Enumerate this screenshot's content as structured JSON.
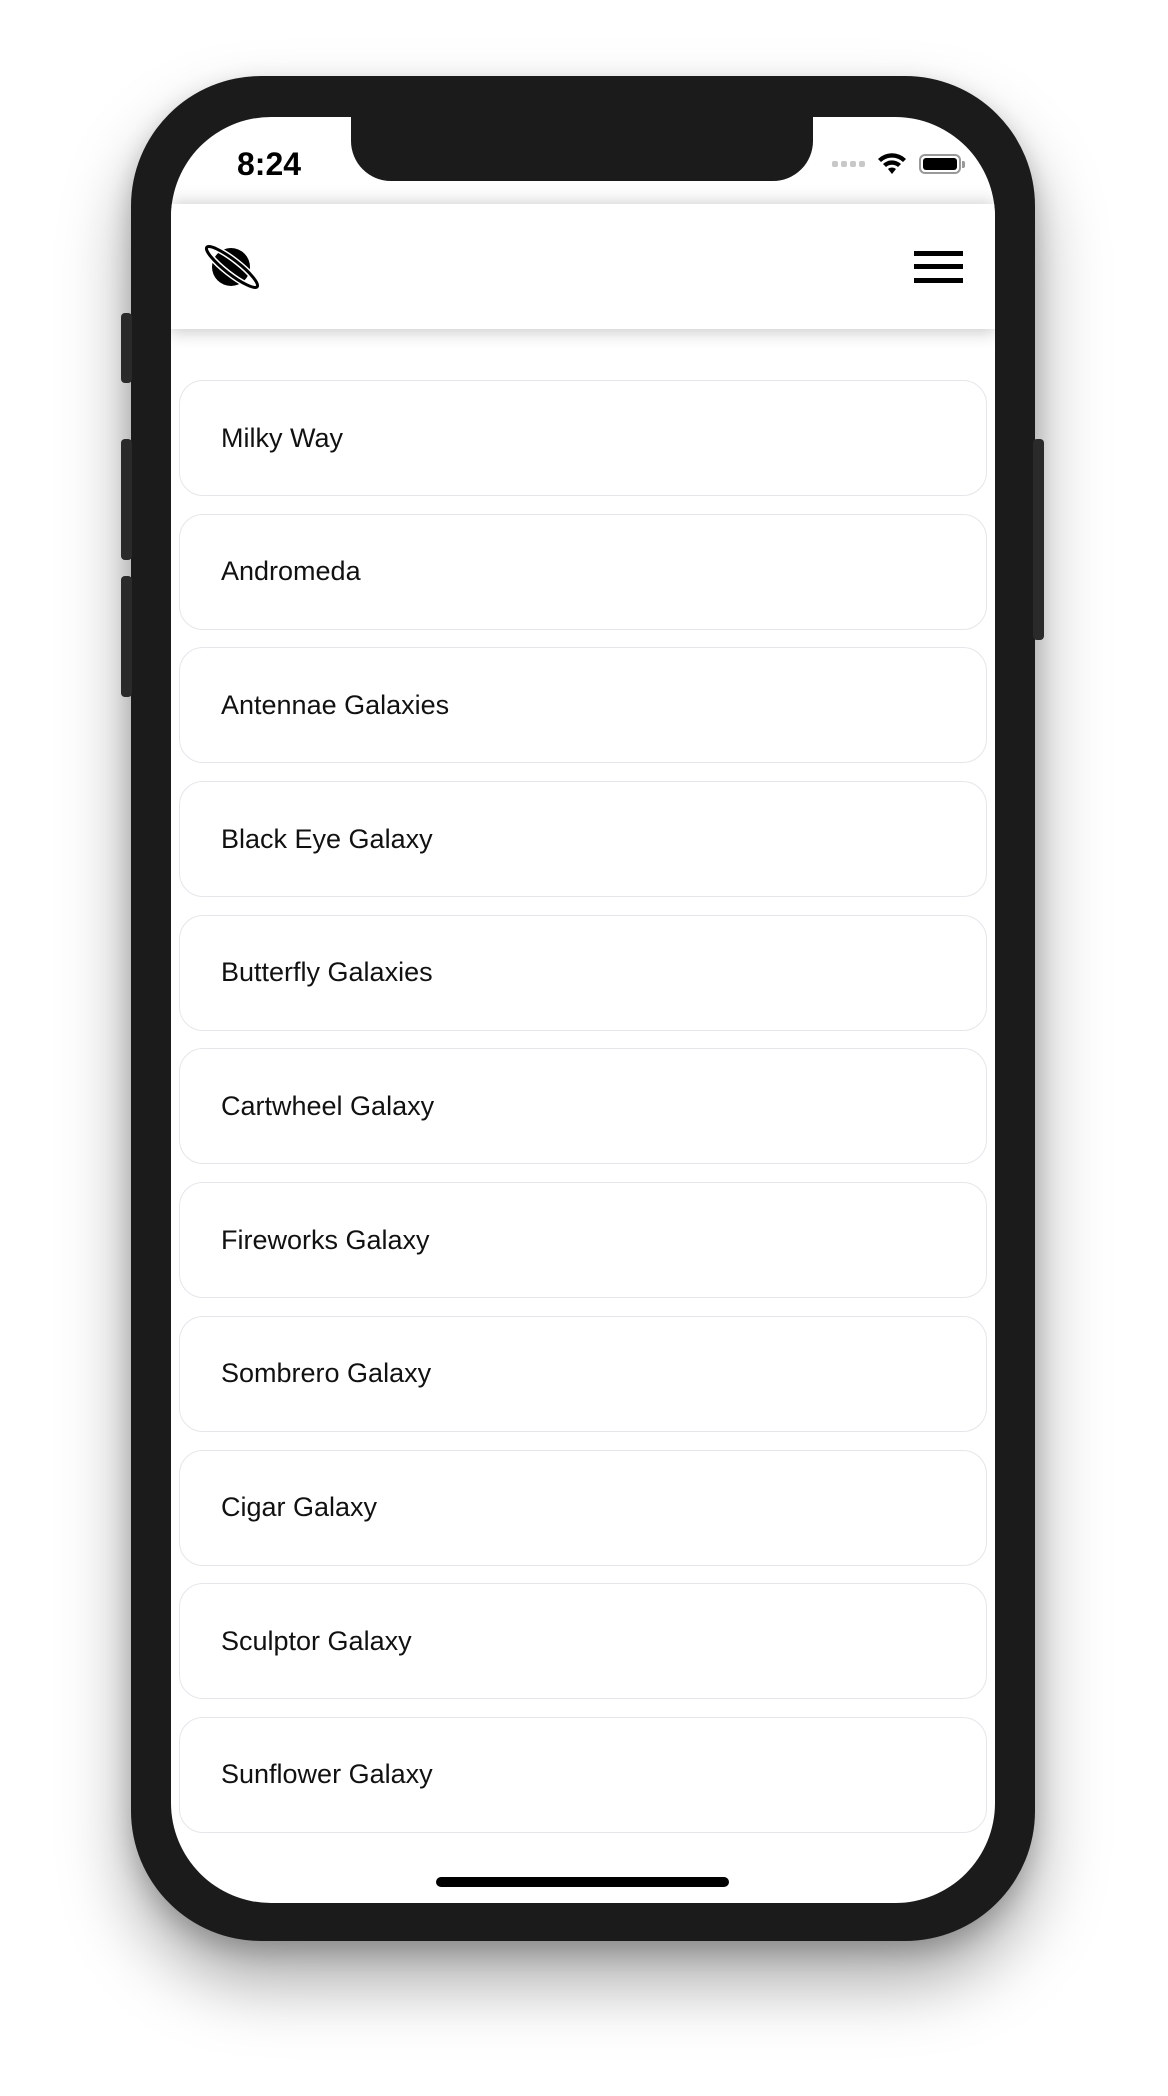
{
  "status_bar": {
    "time": "8:24",
    "icons": [
      "signal-dots-icon",
      "wifi-icon",
      "battery-icon"
    ]
  },
  "header": {
    "logo_icon": "planet-icon",
    "menu_icon": "hamburger-menu-icon"
  },
  "galaxies": [
    {
      "label": "Milky Way"
    },
    {
      "label": "Andromeda"
    },
    {
      "label": "Antennae Galaxies"
    },
    {
      "label": "Black Eye Galaxy"
    },
    {
      "label": "Butterfly Galaxies"
    },
    {
      "label": "Cartwheel Galaxy"
    },
    {
      "label": "Fireworks Galaxy"
    },
    {
      "label": "Sombrero Galaxy"
    },
    {
      "label": "Cigar Galaxy"
    },
    {
      "label": "Sculptor Galaxy"
    },
    {
      "label": "Sunflower Galaxy"
    }
  ]
}
